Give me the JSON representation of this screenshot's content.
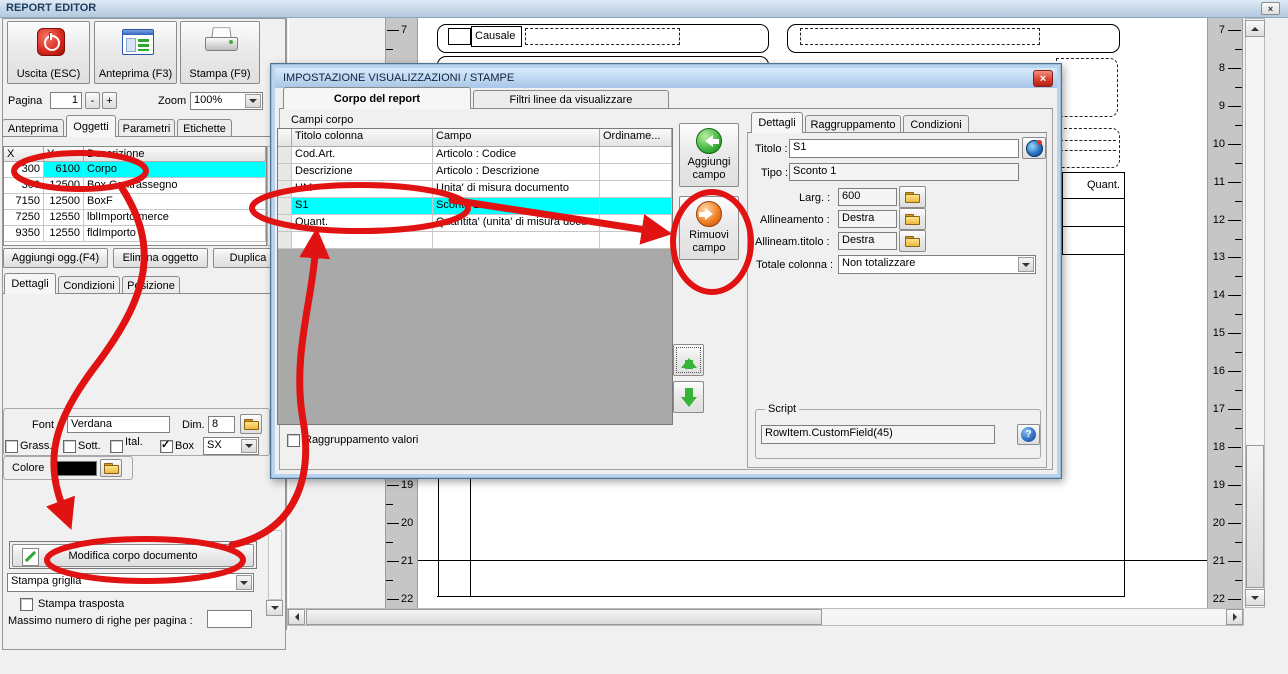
{
  "window": {
    "title": "REPORT EDITOR",
    "close_icon": "×"
  },
  "toolbar": {
    "exit": "Uscita (ESC)",
    "preview": "Anteprima (F3)",
    "print": "Stampa (F9)",
    "page_label": "Pagina",
    "page_value": "1",
    "minus": "-",
    "plus": "+",
    "zoom_label": "Zoom",
    "zoom_value": "100%"
  },
  "main_tabs": {
    "anteprima": "Anteprima",
    "oggetti": "Oggetti",
    "parametri": "Parametri",
    "etichette": "Etichette"
  },
  "objects": {
    "headers": {
      "x": "X",
      "y": "Y",
      "desc": "Descrizione"
    },
    "rows": [
      {
        "x": "300",
        "y": "6100",
        "desc": "Corpo",
        "selected": true
      },
      {
        "x": "300",
        "y": "12500",
        "desc": "Box Contrassegno"
      },
      {
        "x": "7150",
        "y": "12500",
        "desc": "BoxF"
      },
      {
        "x": "7250",
        "y": "12550",
        "desc": "lblImporto merce"
      },
      {
        "x": "9350",
        "y": "12550",
        "desc": "fldImporto"
      }
    ],
    "add": "Aggiungi ogg.(F4)",
    "delete": "Elimina oggetto",
    "duplicate": "Duplica"
  },
  "detail_tabs": {
    "dettagli": "Dettagli",
    "condizioni": "Condizioni",
    "posizione": "Posizione"
  },
  "font": {
    "font_label": "Font :",
    "font_value": "Verdana",
    "dim_label": "Dim.",
    "dim_value": "8",
    "bold": "Grass.",
    "underline": "Sott.",
    "italic": "Ital.",
    "box": "Box",
    "box_check": "✓",
    "align_value": "SX",
    "color_label": "Colore"
  },
  "body_tools": {
    "modify": "Modifica corpo documento",
    "grid_value": "Stampa griglia",
    "transposed": "Stampa trasposta",
    "max_rows": "Massimo numero di righe per pagina :"
  },
  "dialog": {
    "title": "IMPOSTAZIONE VISUALIZZAZIONI / STAMPE",
    "close_icon": "×",
    "tab_body": "Corpo del report",
    "tab_filters": "Filtri linee da visualizzare",
    "group": "Campi corpo",
    "grid": {
      "headers": {
        "titolo": "Titolo colonna",
        "campo": "Campo",
        "ordinamento": "Ordiname..."
      },
      "rows": [
        {
          "titolo": "Cod.Art.",
          "campo": "Articolo : Codice"
        },
        {
          "titolo": "Descrizione",
          "campo": "Articolo : Descrizione"
        },
        {
          "titolo": "UM",
          "campo": "Unita' di misura documento"
        },
        {
          "titolo": "S1",
          "campo": "Sconto 1",
          "selected": true
        },
        {
          "titolo": "Quant.",
          "campo": "Quantita' (unita' di misura docu"
        },
        {
          "titolo": "",
          "campo": ""
        }
      ]
    },
    "add_field": "Aggiungi campo",
    "remove_field": "Rimuovi campo",
    "grouping": "Raggruppamento valori",
    "tabs": {
      "dettagli": "Dettagli",
      "raggruppamento": "Raggruppamento",
      "condizioni": "Condizioni"
    },
    "fields": {
      "titolo_label": "Titolo :",
      "titolo_value": "S1",
      "tipo_label": "Tipo :",
      "tipo_value": "Sconto 1",
      "larg_label": "Larg. :",
      "larg_value": "600",
      "allineamento_label": "Allineamento :",
      "allineamento_value": "Destra",
      "allineam_titolo_label": "Allineam.titolo :",
      "allineam_titolo_value": "Destra",
      "totale_label": "Totale colonna :",
      "totale_value": "Non totalizzare"
    },
    "script_group": "Script",
    "script_value": "RowItem.CustomField(45)",
    "help_icon": "?"
  },
  "document": {
    "causale": "Causale",
    "quant": "Quant.",
    "ruler_numbers": [
      7,
      8,
      9,
      10,
      11,
      12,
      13,
      14,
      15,
      16,
      17,
      18,
      19,
      20,
      21,
      22
    ]
  },
  "annotation_color": "#e11212"
}
